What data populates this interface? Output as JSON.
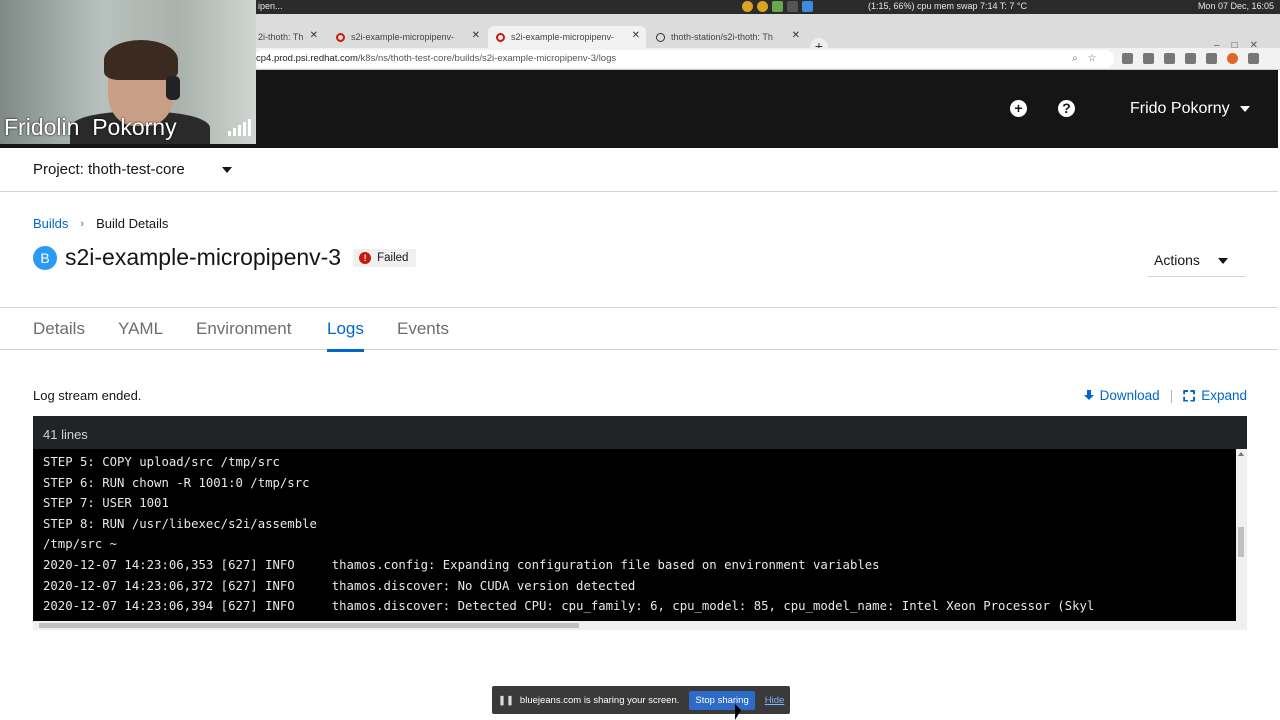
{
  "system": {
    "window_title": "ipen...",
    "status": "(1:15, 66%)   cpu  mem  swap  7:14   T: 7 °C",
    "clock": "Mon 07 Dec, 16:05"
  },
  "browser": {
    "tabs": [
      {
        "label": "2i-thoth: Th"
      },
      {
        "label": "s2i-example-micropipenv-"
      },
      {
        "label": "s2i-example-micropipenv-"
      },
      {
        "label": "thoth-station/s2i-thoth: Th"
      }
    ],
    "url_host": "cp4.prod.psi.redhat.com",
    "url_path": "/k8s/ns/thoth-test-core/builds/s2i-example-micropipenv-3/logs"
  },
  "webcam": {
    "participant_name": "Fridolin  Pokorny"
  },
  "masthead": {
    "user_name": "Frido Pokorny"
  },
  "project": {
    "label": "Project: thoth-test-core"
  },
  "breadcrumb": {
    "parent": "Builds",
    "current": "Build Details"
  },
  "build": {
    "resource_badge": "B",
    "name": "s2i-example-micropipenv-3",
    "status": "Failed",
    "status_color": "#c9190b",
    "actions_label": "Actions"
  },
  "tabs": [
    {
      "label": "Details",
      "active": false
    },
    {
      "label": "YAML",
      "active": false
    },
    {
      "label": "Environment",
      "active": false
    },
    {
      "label": "Logs",
      "active": true
    },
    {
      "label": "Events",
      "active": false
    }
  ],
  "logs": {
    "state": "Log stream ended.",
    "download_label": "Download",
    "expand_label": "Expand",
    "line_count": "41 lines",
    "lines": [
      "STEP 5: COPY upload/src /tmp/src",
      "STEP 6: RUN chown -R 1001:0 /tmp/src",
      "STEP 7: USER 1001",
      "STEP 8: RUN /usr/libexec/s2i/assemble",
      "/tmp/src ~",
      "2020-12-07 14:23:06,353 [627] INFO     thamos.config: Expanding configuration file based on environment variables",
      "2020-12-07 14:23:06,372 [627] INFO     thamos.discover: No CUDA version detected",
      "2020-12-07 14:23:06,394 [627] INFO     thamos.discover: Detected CPU: cpu_family: 6, cpu_model: 85, cpu_model_name: Intel Xeon Processor (Skyl"
    ]
  },
  "screenshare": {
    "message": "bluejeans.com is sharing your screen.",
    "stop_label": "Stop sharing",
    "hide_label": "Hide"
  },
  "colors": {
    "accent": "#06c",
    "masthead": "#151515",
    "log_background": "#000000"
  }
}
